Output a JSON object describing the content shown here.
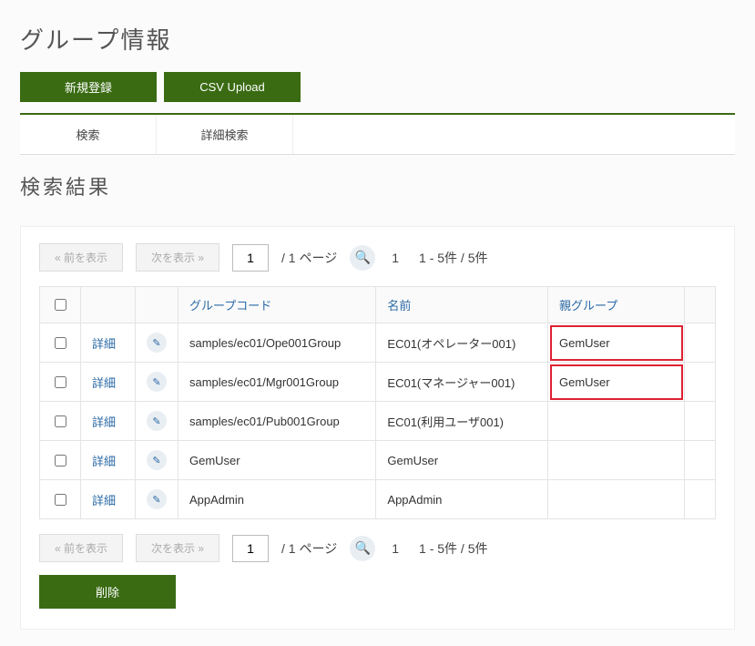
{
  "page_title": "グループ情報",
  "buttons": {
    "new": "新規登録",
    "csv_upload": "CSV Upload",
    "delete": "削除"
  },
  "tabs": {
    "search": "検索",
    "adv_search": "詳細検索"
  },
  "results_heading": "検索結果",
  "pager": {
    "prev": "«  前を表示",
    "next": "次を表示  »",
    "page_value": "1",
    "page_of": "/  1 ページ",
    "current_page": "1",
    "stats": "1 - 5件 / 5件"
  },
  "columns": {
    "code": "グループコード",
    "name": "名前",
    "parent": "親グループ"
  },
  "detail_label": "詳細",
  "rows": [
    {
      "code": "samples/ec01/Ope001Group",
      "name": "EC01(オペレーター001)",
      "parent": "GemUser",
      "highlight_parent": true
    },
    {
      "code": "samples/ec01/Mgr001Group",
      "name": "EC01(マネージャー001)",
      "parent": "GemUser",
      "highlight_parent": true
    },
    {
      "code": "samples/ec01/Pub001Group",
      "name": "EC01(利用ユーザ001)",
      "parent": "",
      "highlight_parent": false
    },
    {
      "code": "GemUser",
      "name": "GemUser",
      "parent": "",
      "highlight_parent": false
    },
    {
      "code": "AppAdmin",
      "name": "AppAdmin",
      "parent": "",
      "highlight_parent": false
    }
  ]
}
